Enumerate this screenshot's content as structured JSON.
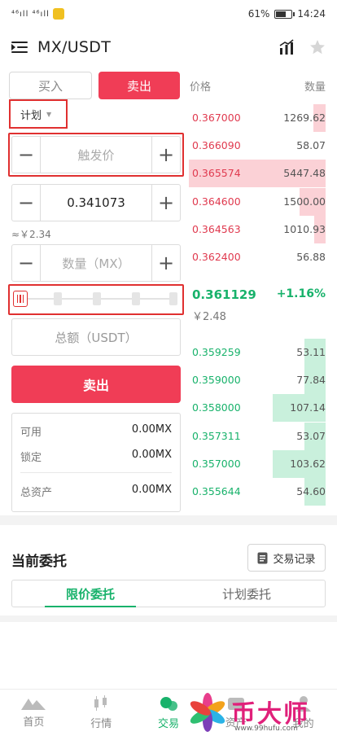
{
  "status_bar": {
    "signal": "⁴⁶ıll ⁴⁶ıll",
    "battery": "61%",
    "time": "14:24"
  },
  "header": {
    "title": "MX/USDT"
  },
  "trade_tabs": {
    "buy": "买入",
    "sell": "卖出"
  },
  "order_type": {
    "selected": "计划"
  },
  "trigger_input": {
    "placeholder": "触发价"
  },
  "price_input": {
    "value": "0.341073"
  },
  "approx_cny": "≈￥2.34",
  "amount_input": {
    "placeholder": "数量（MX）"
  },
  "slider": {
    "level": 0
  },
  "total_input": {
    "placeholder": "总额（USDT）"
  },
  "sell_button": "卖出",
  "balance": {
    "available_label": "可用",
    "available_value": "0.00MX",
    "locked_label": "锁定",
    "locked_value": "0.00MX",
    "total_label": "总资产",
    "total_value": "0.00MX"
  },
  "orderbook": {
    "price_header": "价格",
    "amount_header": "数量",
    "asks": [
      {
        "price": "0.367000",
        "amount": "1269.62",
        "depth": 0.09
      },
      {
        "price": "0.366090",
        "amount": "58.07",
        "depth": 0.0
      },
      {
        "price": "0.365574",
        "amount": "5447.48",
        "depth": 1.0
      },
      {
        "price": "0.364600",
        "amount": "1500.00",
        "depth": 0.19
      },
      {
        "price": "0.364563",
        "amount": "1010.93",
        "depth": 0.07
      },
      {
        "price": "0.362400",
        "amount": "56.88",
        "depth": 0.0
      }
    ],
    "last_price": "0.361129",
    "change": "+1.16%",
    "last_cny": "￥2.48",
    "bids": [
      {
        "price": "0.359259",
        "amount": "53.11",
        "depth": 0.4
      },
      {
        "price": "0.359000",
        "amount": "77.84",
        "depth": 0.4
      },
      {
        "price": "0.358000",
        "amount": "107.14",
        "depth": 0.98
      },
      {
        "price": "0.357311",
        "amount": "53.07",
        "depth": 0.4
      },
      {
        "price": "0.357000",
        "amount": "103.62",
        "depth": 0.98
      },
      {
        "price": "0.355644",
        "amount": "54.60",
        "depth": 0.4
      }
    ]
  },
  "orders": {
    "title": "当前委托",
    "records_button": "交易记录",
    "tab_limit": "限价委托",
    "tab_plan": "计划委托"
  },
  "bottom_nav": {
    "home": "首页",
    "market": "行情",
    "trade": "交易",
    "assets": "资产",
    "mine": "我的"
  },
  "watermark": {
    "text": "币大师",
    "url": "www.99hufu.com"
  },
  "colors": {
    "sell": "#f03d56",
    "buy": "#18b26b",
    "highlight": "#e03030"
  }
}
